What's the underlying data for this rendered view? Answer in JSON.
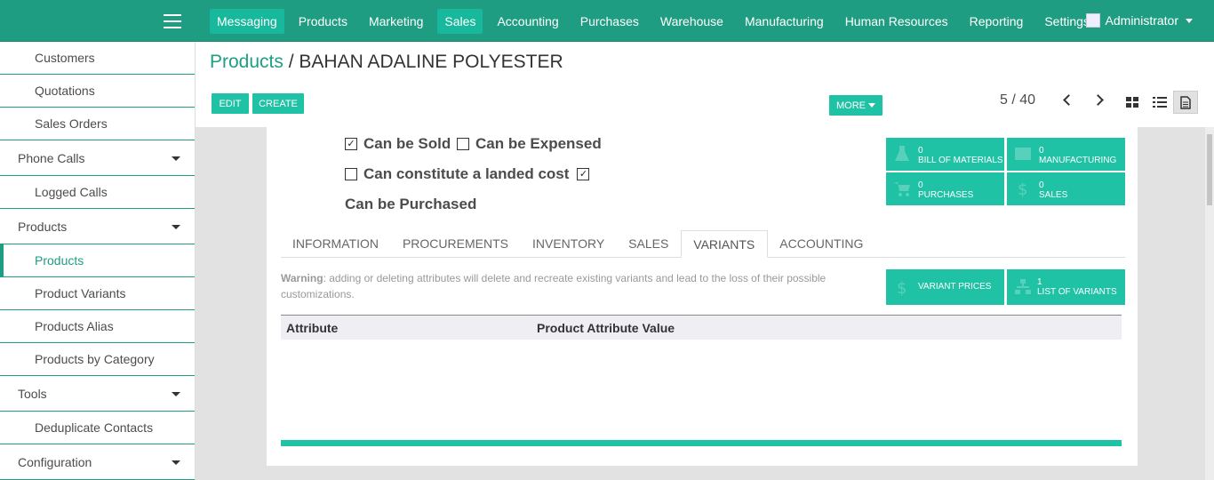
{
  "topbar": {
    "menu": [
      "Messaging",
      "Products",
      "Marketing",
      "Sales",
      "Accounting",
      "Purchases",
      "Warehouse",
      "Manufacturing",
      "Human Resources",
      "Reporting",
      "Settings"
    ],
    "user": "Administrator"
  },
  "sidebar": {
    "items": [
      {
        "label": "Customers"
      },
      {
        "label": "Quotations"
      },
      {
        "label": "Sales Orders"
      },
      {
        "label": "Phone Calls"
      },
      {
        "label": "Logged Calls"
      },
      {
        "label": "Products"
      },
      {
        "label": "Products"
      },
      {
        "label": "Product Variants"
      },
      {
        "label": "Products Alias"
      },
      {
        "label": "Products by Category"
      },
      {
        "label": "Tools"
      },
      {
        "label": "Deduplicate Contacts"
      },
      {
        "label": "Configuration"
      }
    ]
  },
  "control": {
    "breadcrumb_link": "Products",
    "breadcrumb_sep": "/",
    "breadcrumb_current": "BAHAN ADALINE POLYESTER",
    "edit_label": "EDIT",
    "create_label": "CREATE",
    "more_label": "MORE",
    "pager": "5 / 40"
  },
  "form": {
    "can_be_sold": "Can be Sold",
    "can_be_expensed": "Can be Expensed",
    "landed_cost": "Can constitute a landed cost",
    "can_be_purchased": "Can be Purchased",
    "stats": [
      {
        "count": "0",
        "label": "BILL OF MATERIALS"
      },
      {
        "count": "0",
        "label": "MANUFACTURING"
      },
      {
        "count": "0",
        "label": "PURCHASES"
      },
      {
        "count": "0",
        "label": "SALES"
      }
    ],
    "tabs": [
      "INFORMATION",
      "PROCUREMENTS",
      "INVENTORY",
      "SALES",
      "VARIANTS",
      "ACCOUNTING"
    ],
    "warning_bold": "Warning",
    "warning_text": ": adding or deleting attributes will delete and recreate existing variants and lead to the loss of their possible customizations.",
    "variant_prices": "VARIANT PRICES",
    "list_of_variants_count": "1",
    "list_of_variants": "LIST OF VARIANTS",
    "col_attribute": "Attribute",
    "col_value": "Product Attribute Value"
  },
  "colors": {
    "brand": "#1f9d82",
    "accent": "#1fc2a5"
  }
}
